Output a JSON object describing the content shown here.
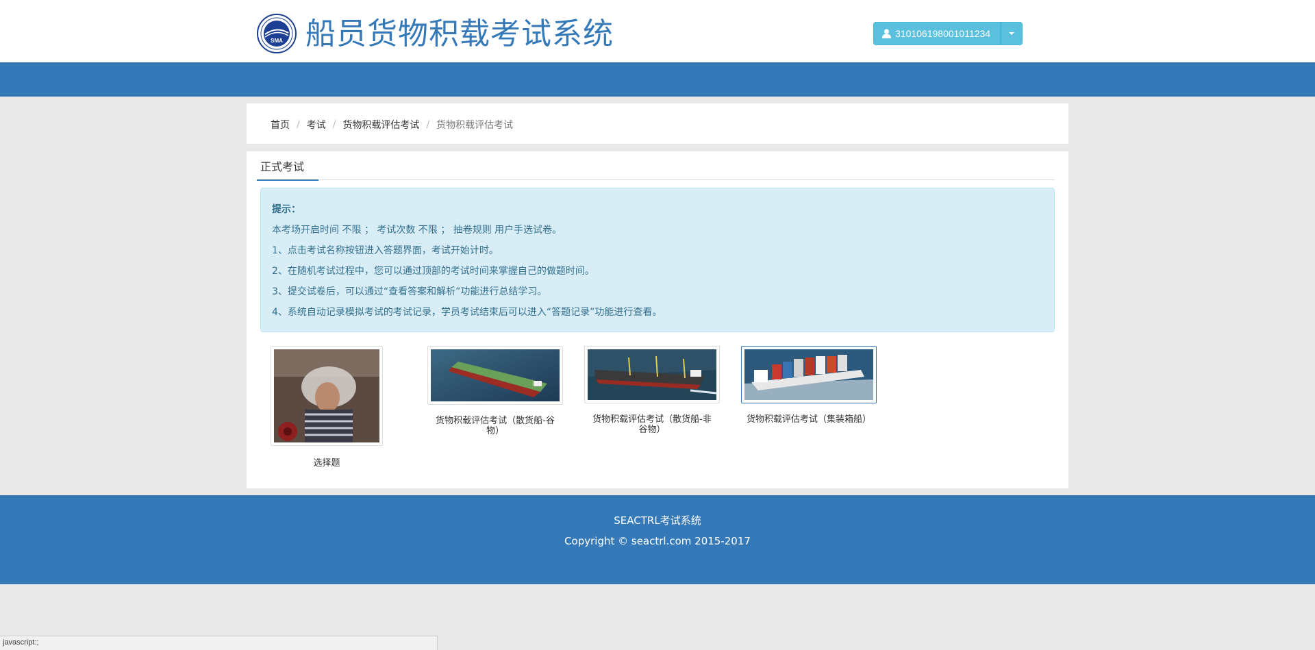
{
  "header": {
    "logo_text": "SMA",
    "title": "船员货物积载考试系统",
    "user_id": "310106198001011234",
    "user_icon": "user-icon",
    "dropdown_icon": "caret-down-icon"
  },
  "colors": {
    "primary": "#3579b9",
    "info_bg": "#d9edf7",
    "info_text": "#31708f",
    "user_btn": "#5bc0de"
  },
  "breadcrumb": [
    {
      "label": "首页"
    },
    {
      "label": "考试"
    },
    {
      "label": "货物积载评估考试"
    },
    {
      "label": "货物积载评估考试"
    }
  ],
  "tabs": {
    "active": "正式考试"
  },
  "tips": {
    "title": "提示：",
    "lines": [
      "本考场开启时间 不限 ； 考试次数 不限 ； 抽卷规则 用户手选试卷。",
      "1、点击考试名称按钮进入答题界面，考试开始计时。",
      "2、在随机考试过程中，您可以通过顶部的考试时间来掌握自己的做题时间。",
      "3、提交试卷后，可以通过“查看答案和解析”功能进行总结学习。",
      "4、系统自动记录模拟考试的考试记录，学员考试结束后可以进入“答题记录”功能进行查看。"
    ]
  },
  "exams": [
    {
      "label": "选择题",
      "image": "worker-photo"
    },
    {
      "label": "货物积载评估考试（散货船-谷物）",
      "image": "bulk-carrier-photo"
    },
    {
      "label": "货物积载评估考试（散货船-非谷物）",
      "image": "bulk-carrier-crane-photo"
    },
    {
      "label": "货物积载评估考试（集装箱船）",
      "image": "container-ship-photo"
    }
  ],
  "footer": {
    "line1": "SEACTRL考试系统",
    "line2": "Copyright © seactrl.com 2015-2017"
  },
  "statusbar": "javascript:;"
}
